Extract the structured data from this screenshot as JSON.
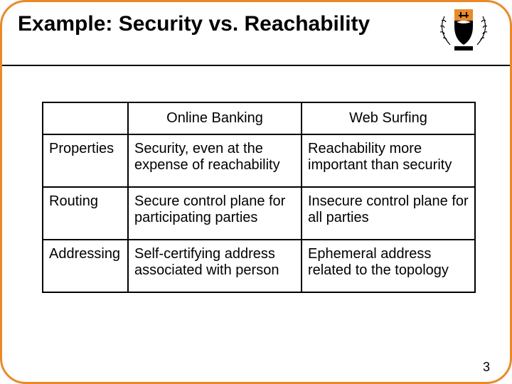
{
  "title": "Example: Security vs. Reachability",
  "slide_number": "3",
  "table": {
    "columns": [
      "",
      "Online Banking",
      "Web Surfing"
    ],
    "rows": [
      {
        "label": "Properties",
        "banking": "Security, even at the expense of reachability",
        "surfing": "Reachability more important than security"
      },
      {
        "label": "Routing",
        "banking": "Secure control plane for participating parties",
        "surfing": "Insecure control plane for all parties"
      },
      {
        "label": "Addressing",
        "banking": "Self-certifying address associated with person",
        "surfing": "Ephemeral address related to the topology"
      }
    ]
  }
}
